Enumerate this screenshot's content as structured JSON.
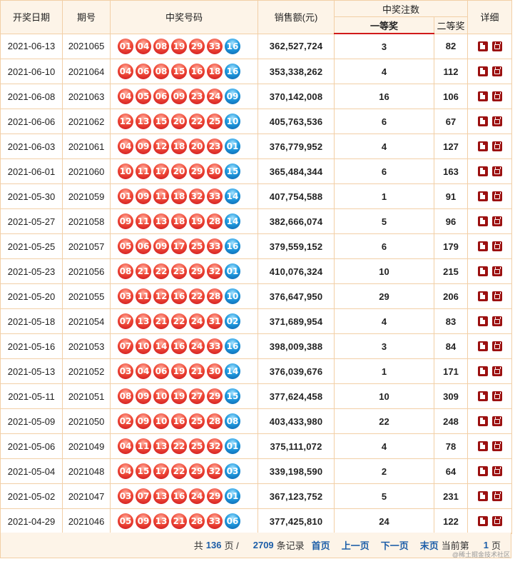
{
  "header": {
    "date": "开奖日期",
    "issue": "期号",
    "numbers": "中奖号码",
    "sales": "销售额(元)",
    "winners": "中奖注数",
    "first": "一等奖",
    "second": "二等奖",
    "detail": "详细"
  },
  "rows": [
    {
      "date": "2021-06-13",
      "issue": "2021065",
      "red": [
        "01",
        "04",
        "08",
        "19",
        "29",
        "33"
      ],
      "blue": "16",
      "sales": "362,527,724",
      "first": "3",
      "second": "82"
    },
    {
      "date": "2021-06-10",
      "issue": "2021064",
      "red": [
        "04",
        "06",
        "08",
        "15",
        "16",
        "18"
      ],
      "blue": "16",
      "sales": "353,338,262",
      "first": "4",
      "second": "112"
    },
    {
      "date": "2021-06-08",
      "issue": "2021063",
      "red": [
        "04",
        "05",
        "06",
        "09",
        "23",
        "24"
      ],
      "blue": "09",
      "sales": "370,142,008",
      "first": "16",
      "second": "106"
    },
    {
      "date": "2021-06-06",
      "issue": "2021062",
      "red": [
        "12",
        "13",
        "15",
        "20",
        "22",
        "25"
      ],
      "blue": "10",
      "sales": "405,763,536",
      "first": "6",
      "second": "67"
    },
    {
      "date": "2021-06-03",
      "issue": "2021061",
      "red": [
        "04",
        "09",
        "12",
        "18",
        "20",
        "23"
      ],
      "blue": "01",
      "sales": "376,779,952",
      "first": "4",
      "second": "127"
    },
    {
      "date": "2021-06-01",
      "issue": "2021060",
      "red": [
        "10",
        "11",
        "17",
        "20",
        "29",
        "30"
      ],
      "blue": "15",
      "sales": "365,484,344",
      "first": "6",
      "second": "163"
    },
    {
      "date": "2021-05-30",
      "issue": "2021059",
      "red": [
        "01",
        "09",
        "11",
        "18",
        "32",
        "33"
      ],
      "blue": "14",
      "sales": "407,754,588",
      "first": "1",
      "second": "91"
    },
    {
      "date": "2021-05-27",
      "issue": "2021058",
      "red": [
        "09",
        "11",
        "13",
        "18",
        "19",
        "28"
      ],
      "blue": "14",
      "sales": "382,666,074",
      "first": "5",
      "second": "96"
    },
    {
      "date": "2021-05-25",
      "issue": "2021057",
      "red": [
        "05",
        "06",
        "09",
        "17",
        "25",
        "33"
      ],
      "blue": "16",
      "sales": "379,559,152",
      "first": "6",
      "second": "179"
    },
    {
      "date": "2021-05-23",
      "issue": "2021056",
      "red": [
        "08",
        "21",
        "22",
        "23",
        "29",
        "32"
      ],
      "blue": "01",
      "sales": "410,076,324",
      "first": "10",
      "second": "215"
    },
    {
      "date": "2021-05-20",
      "issue": "2021055",
      "red": [
        "03",
        "11",
        "12",
        "16",
        "22",
        "28"
      ],
      "blue": "10",
      "sales": "376,647,950",
      "first": "29",
      "second": "206"
    },
    {
      "date": "2021-05-18",
      "issue": "2021054",
      "red": [
        "07",
        "13",
        "21",
        "22",
        "24",
        "31"
      ],
      "blue": "02",
      "sales": "371,689,954",
      "first": "4",
      "second": "83"
    },
    {
      "date": "2021-05-16",
      "issue": "2021053",
      "red": [
        "07",
        "10",
        "14",
        "16",
        "24",
        "33"
      ],
      "blue": "16",
      "sales": "398,009,388",
      "first": "3",
      "second": "84"
    },
    {
      "date": "2021-05-13",
      "issue": "2021052",
      "red": [
        "03",
        "04",
        "06",
        "19",
        "21",
        "30"
      ],
      "blue": "14",
      "sales": "376,039,676",
      "first": "1",
      "second": "171"
    },
    {
      "date": "2021-05-11",
      "issue": "2021051",
      "red": [
        "08",
        "09",
        "10",
        "19",
        "27",
        "29"
      ],
      "blue": "15",
      "sales": "377,624,458",
      "first": "10",
      "second": "309"
    },
    {
      "date": "2021-05-09",
      "issue": "2021050",
      "red": [
        "02",
        "09",
        "10",
        "16",
        "25",
        "28"
      ],
      "blue": "08",
      "sales": "403,433,980",
      "first": "22",
      "second": "248"
    },
    {
      "date": "2021-05-06",
      "issue": "2021049",
      "red": [
        "04",
        "11",
        "13",
        "22",
        "25",
        "32"
      ],
      "blue": "01",
      "sales": "375,111,072",
      "first": "4",
      "second": "78"
    },
    {
      "date": "2021-05-04",
      "issue": "2021048",
      "red": [
        "04",
        "15",
        "17",
        "22",
        "29",
        "32"
      ],
      "blue": "03",
      "sales": "339,198,590",
      "first": "2",
      "second": "64"
    },
    {
      "date": "2021-05-02",
      "issue": "2021047",
      "red": [
        "03",
        "07",
        "13",
        "16",
        "24",
        "29"
      ],
      "blue": "01",
      "sales": "367,123,752",
      "first": "5",
      "second": "231"
    },
    {
      "date": "2021-04-29",
      "issue": "2021046",
      "red": [
        "05",
        "09",
        "13",
        "21",
        "28",
        "33"
      ],
      "blue": "06",
      "sales": "377,425,810",
      "first": "24",
      "second": "122"
    }
  ],
  "icons": {
    "doc": "document-icon",
    "tv": "video-icon"
  },
  "pager": {
    "total_prefix": "共",
    "total_pages": "136",
    "pages_suffix": "页 /",
    "total_records": "2709",
    "records_suffix": "条记录",
    "first": "首页",
    "prev": "上一页",
    "next": "下一页",
    "last": "末页",
    "current_prefix": "当前第",
    "current_page": "1",
    "current_suffix": "页"
  },
  "watermark": "@稀土掘金技术社区",
  "colors": {
    "red_ball": "#e0281e",
    "blue_ball": "#1f8fd6",
    "header_bg": "#fdf4e8",
    "border": "#f2cfa6",
    "sales_text": "#b3001b",
    "second_text": "#1c5ea8"
  }
}
